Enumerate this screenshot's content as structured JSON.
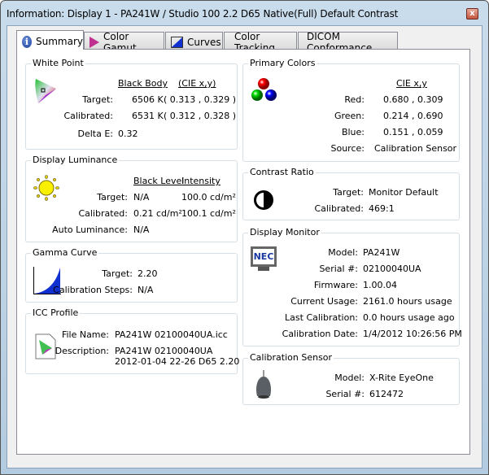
{
  "window": {
    "title": "Information: Display 1 - PA241W / Studio 100 2.2 D65 Native(Full) Default Contrast",
    "close_label": "x"
  },
  "tabs": [
    {
      "label": "Summary",
      "icon": "info-icon"
    },
    {
      "label": "Color Gamut",
      "icon": "gamut-icon"
    },
    {
      "label": "Curves",
      "icon": "curve-icon"
    },
    {
      "label": "Color Tracking"
    },
    {
      "label": "DICOM Conformance"
    }
  ],
  "white_point": {
    "title": "White Point",
    "col1": "Black Body",
    "col2": "(CIE x,y)",
    "target_label": "Target:",
    "target_k": "6506 K",
    "target_xy": "( 0.313 , 0.329 )",
    "cal_label": "Calibrated:",
    "cal_k": "6531 K",
    "cal_xy": "( 0.312 , 0.328 )",
    "delta_label": "Delta E:",
    "delta": "0.32"
  },
  "luminance": {
    "title": "Display Luminance",
    "col1": "Black Level",
    "col2": "Intensity",
    "target_label": "Target:",
    "target_black": "N/A",
    "target_int": "100.0 cd/m²",
    "cal_label": "Calibrated:",
    "cal_black": "0.21 cd/m²",
    "cal_int": "100.1 cd/m²",
    "auto_label": "Auto Luminance:",
    "auto": "N/A"
  },
  "gamma": {
    "title": "Gamma Curve",
    "target_label": "Target:",
    "target": "2.20",
    "steps_label": "Calibration Steps:",
    "steps": "N/A"
  },
  "icc": {
    "title": "ICC Profile",
    "file_label": "File Name:",
    "file": "PA241W 02100040UA.icc",
    "desc_label": "Description:",
    "desc1": "PA241W 02100040UA",
    "desc2": "2012-01-04 22-26 D65 2.20"
  },
  "primaries": {
    "title": "Primary Colors",
    "col": "CIE x,y",
    "red_label": "Red:",
    "red": "0.680 , 0.309",
    "green_label": "Green:",
    "green": "0.214 , 0.690",
    "blue_label": "Blue:",
    "blue": "0.151 , 0.059",
    "source_label": "Source:",
    "source": "Calibration Sensor"
  },
  "contrast": {
    "title": "Contrast Ratio",
    "target_label": "Target:",
    "target": "Monitor Default",
    "cal_label": "Calibrated:",
    "cal": "469:1"
  },
  "monitor": {
    "title": "Display Monitor",
    "logo": "NEC",
    "rows": [
      {
        "label": "Model:",
        "value": "PA241W"
      },
      {
        "label": "Serial #:",
        "value": "02100040UA"
      },
      {
        "label": "Firmware:",
        "value": "1.00.04"
      },
      {
        "label": "Current Usage:",
        "value": "2161.0 hours usage"
      },
      {
        "label": "Last Calibration:",
        "value": "0.0 hours usage ago"
      },
      {
        "label": "Calibration Date:",
        "value": "1/4/2012 10:26:56 PM"
      }
    ]
  },
  "sensor": {
    "title": "Calibration Sensor",
    "model_label": "Model:",
    "model": "X-Rite EyeOne",
    "serial_label": "Serial #:",
    "serial": "612472"
  }
}
